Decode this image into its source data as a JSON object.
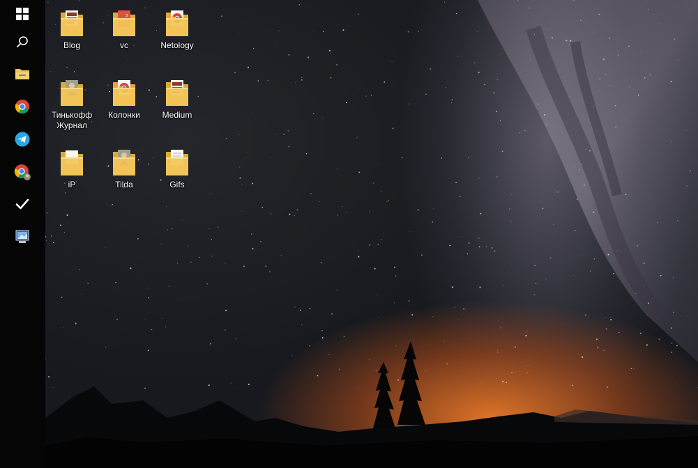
{
  "taskbar": {
    "items": [
      {
        "name": "start-button",
        "icon": "windows-logo-icon"
      },
      {
        "name": "search-button",
        "icon": "search-icon"
      },
      {
        "name": "file-explorer-button",
        "icon": "folder-icon"
      },
      {
        "name": "chrome-button",
        "icon": "chrome-icon"
      },
      {
        "name": "telegram-button",
        "icon": "telegram-icon"
      },
      {
        "name": "chrome-profile-button",
        "icon": "chrome-profile-icon"
      },
      {
        "name": "todo-button",
        "icon": "checkmark-icon"
      },
      {
        "name": "remote-app-button",
        "icon": "remote-desktop-icon"
      }
    ]
  },
  "desktop": {
    "icons": [
      {
        "label": "Blog",
        "type": "folder",
        "preview": "photos"
      },
      {
        "label": "vc",
        "type": "folder",
        "preview": "red-document"
      },
      {
        "label": "Netology",
        "type": "folder",
        "preview": "chrome"
      },
      {
        "label": "Тинькофф\nЖурнал",
        "type": "folder",
        "preview": "portrait"
      },
      {
        "label": "Колонки",
        "type": "folder",
        "preview": "chrome"
      },
      {
        "label": "Medium",
        "type": "folder",
        "preview": "photos"
      },
      {
        "label": "iP",
        "type": "folder",
        "preview": "empty"
      },
      {
        "label": "Tilda",
        "type": "folder",
        "preview": "portrait"
      },
      {
        "label": "Gifs",
        "type": "folder",
        "preview": "document"
      }
    ]
  },
  "colors": {
    "taskbar": "#050506",
    "folder": "#f3c65a",
    "horizon_glow": "#e8782a"
  }
}
